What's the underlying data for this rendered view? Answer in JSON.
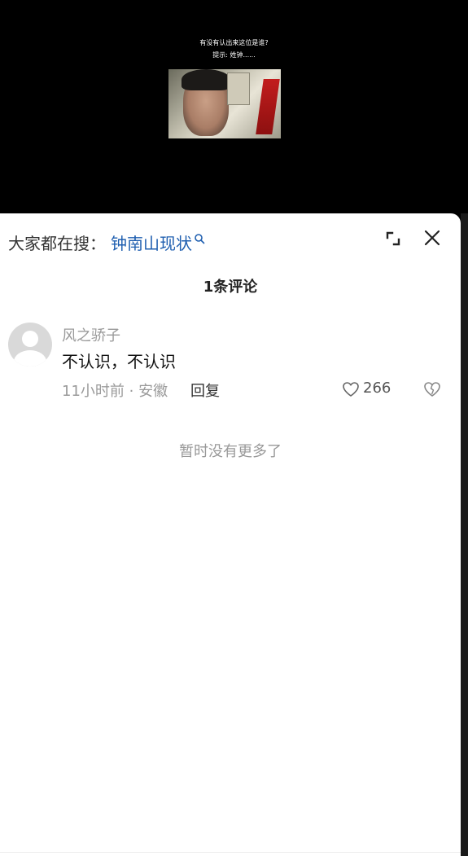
{
  "video": {
    "caption_line1": "有没有认出来这位是谁?",
    "caption_line2": "提示: 姓钟......"
  },
  "search_bar": {
    "prefix": "大家都在搜：",
    "term": "钟南山现状",
    "term_color": "#1f5fb0"
  },
  "comments_header": {
    "count_label": "1条评论"
  },
  "comments": [
    {
      "username": "风之骄子",
      "text": "不认识，不认识",
      "meta": "11小时前 · 安徽",
      "reply_label": "回复",
      "likes": "266"
    }
  ],
  "footer": {
    "no_more": "暂时没有更多了"
  },
  "icons": {
    "search": "search-icon",
    "expand": "expand-icon",
    "close": "close-icon",
    "like": "heart-icon",
    "dislike": "broken-heart-icon",
    "avatar": "default-avatar"
  }
}
